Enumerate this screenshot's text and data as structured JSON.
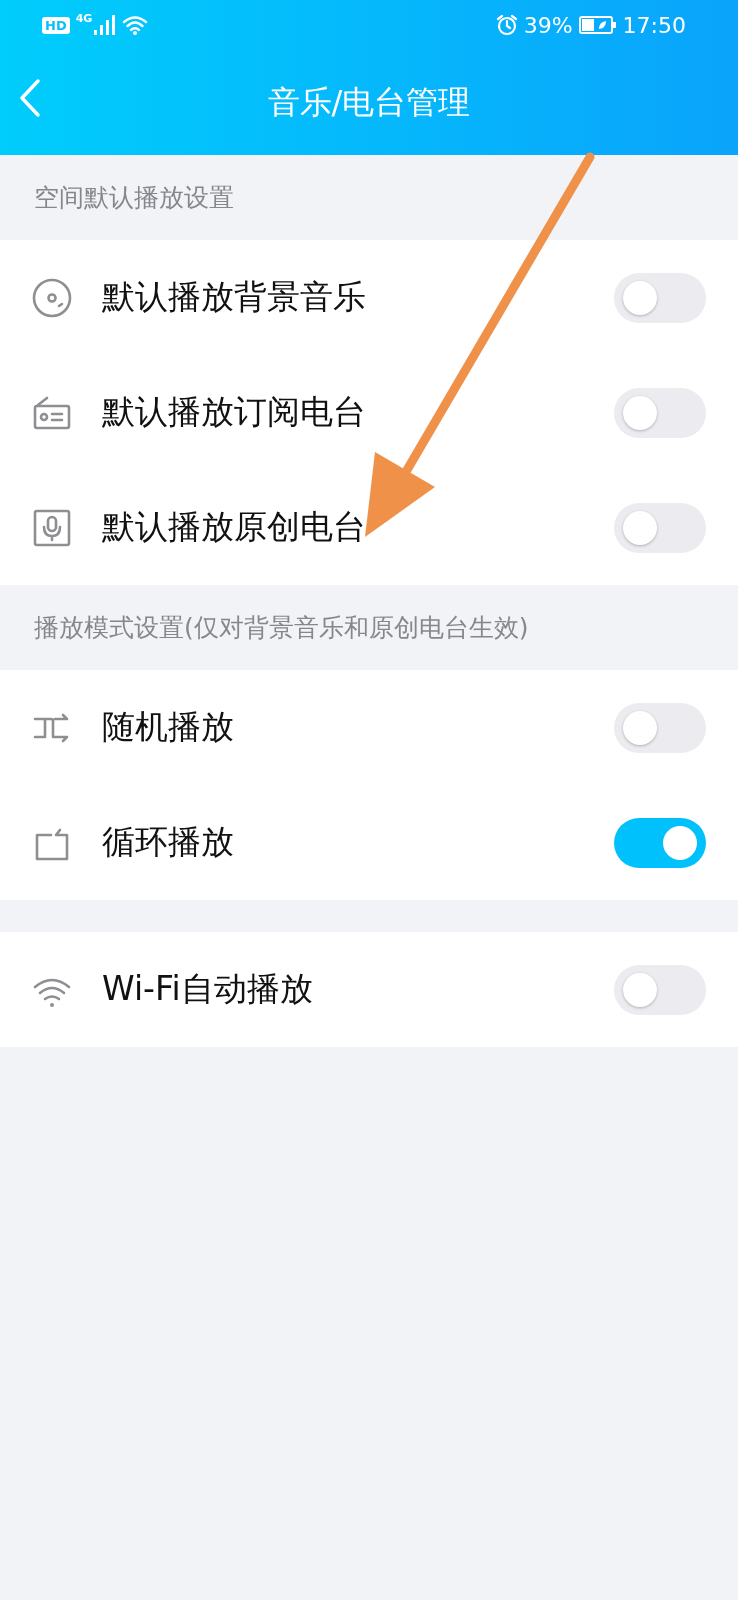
{
  "status_bar": {
    "hd": "HD",
    "network": "4G",
    "battery": "39%",
    "time": "17:50"
  },
  "header": {
    "title": "音乐/电台管理"
  },
  "sections": [
    {
      "title": "空间默认播放设置",
      "items": [
        {
          "kind": "disc",
          "label": "默认播放背景音乐",
          "on": false
        },
        {
          "kind": "radio",
          "label": "默认播放订阅电台",
          "on": false
        },
        {
          "kind": "mic",
          "label": "默认播放原创电台",
          "on": false
        }
      ]
    },
    {
      "title": "播放模式设置(仅对背景音乐和原创电台生效)",
      "items": [
        {
          "kind": "shuffle",
          "label": "随机播放",
          "on": false
        },
        {
          "kind": "repeat",
          "label": "循环播放",
          "on": true
        }
      ]
    },
    {
      "items": [
        {
          "kind": "wifi",
          "label": "Wi-Fi自动播放",
          "on": false
        }
      ]
    }
  ]
}
